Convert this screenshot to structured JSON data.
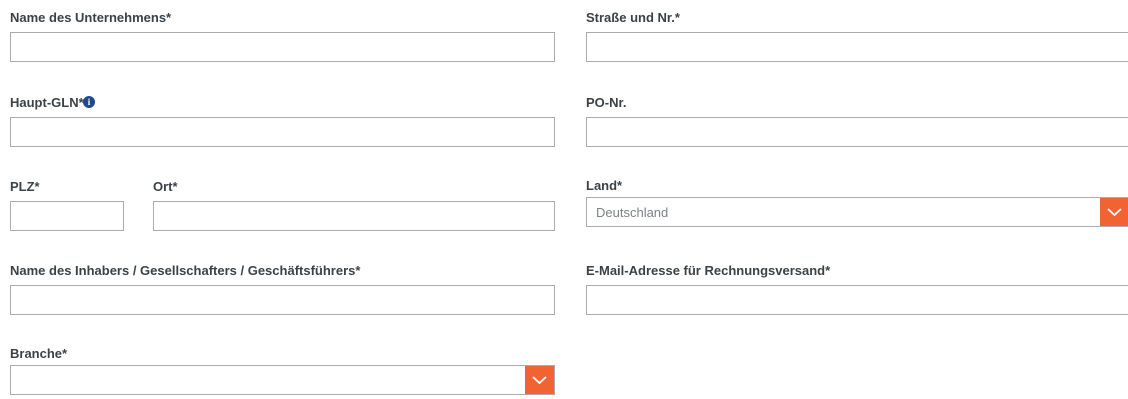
{
  "form": {
    "company_name": {
      "label": "Name des Unternehmens*",
      "value": ""
    },
    "street": {
      "label": "Straße und Nr.*",
      "value": ""
    },
    "main_gln": {
      "label": "Haupt-GLN*",
      "value": ""
    },
    "po_number": {
      "label": "PO-Nr.",
      "value": ""
    },
    "zip": {
      "label": "PLZ*",
      "value": ""
    },
    "city": {
      "label": "Ort*",
      "value": ""
    },
    "country": {
      "label": "Land*",
      "value": "Deutschland"
    },
    "owner_name": {
      "label": "Name des Inhabers / Gesellschafters / Geschäftsführers*",
      "value": ""
    },
    "invoice_email": {
      "label": "E-Mail-Adresse für Rechnungsversand*",
      "value": ""
    },
    "industry": {
      "label": "Branche*",
      "value": ""
    }
  },
  "icons": {
    "info": "info-icon",
    "dropdown": "chevron-down-icon"
  },
  "colors": {
    "accent": "#f26334",
    "info": "#1f4b8e",
    "border": "#a8acb0",
    "label": "#3b4247"
  }
}
